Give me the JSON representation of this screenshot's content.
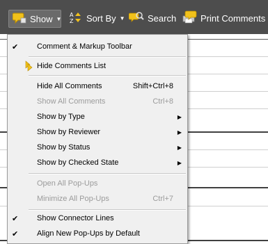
{
  "toolbar": {
    "show_label": "Show",
    "sort_label": "Sort By",
    "search_label": "Search",
    "print_label": "Print Comments"
  },
  "menu": {
    "items": [
      {
        "check": "✔",
        "label": "Comment & Markup Toolbar",
        "shortcut": "",
        "submenu": false,
        "disabled": false
      },
      {
        "check": "",
        "label": "Hide Comments List",
        "shortcut": "",
        "submenu": false,
        "disabled": false
      },
      {
        "check": "",
        "label": "Hide All Comments",
        "shortcut": "Shift+Ctrl+8",
        "submenu": false,
        "disabled": false
      },
      {
        "check": "",
        "label": "Show All Comments",
        "shortcut": "Ctrl+8",
        "submenu": false,
        "disabled": true
      },
      {
        "check": "",
        "label": "Show by Type",
        "shortcut": "",
        "submenu": true,
        "disabled": false
      },
      {
        "check": "",
        "label": "Show by Reviewer",
        "shortcut": "",
        "submenu": true,
        "disabled": false
      },
      {
        "check": "",
        "label": "Show by Status",
        "shortcut": "",
        "submenu": true,
        "disabled": false
      },
      {
        "check": "",
        "label": "Show by Checked State",
        "shortcut": "",
        "submenu": true,
        "disabled": false
      },
      {
        "check": "",
        "label": "Open All Pop-Ups",
        "shortcut": "",
        "submenu": false,
        "disabled": true
      },
      {
        "check": "",
        "label": "Minimize All Pop-Ups",
        "shortcut": "Ctrl+7",
        "submenu": false,
        "disabled": true
      },
      {
        "check": "✔",
        "label": "Show Connector Lines",
        "shortcut": "",
        "submenu": false,
        "disabled": false
      },
      {
        "check": "✔",
        "label": "Align New Pop-Ups by Default",
        "shortcut": "",
        "submenu": false,
        "disabled": false
      }
    ],
    "submenu_arrow": "▶"
  },
  "colors": {
    "toolbar_bg": "#4d4d4d",
    "menu_bg": "#f0f0f0",
    "icon_yellow": "#f2c21b"
  }
}
